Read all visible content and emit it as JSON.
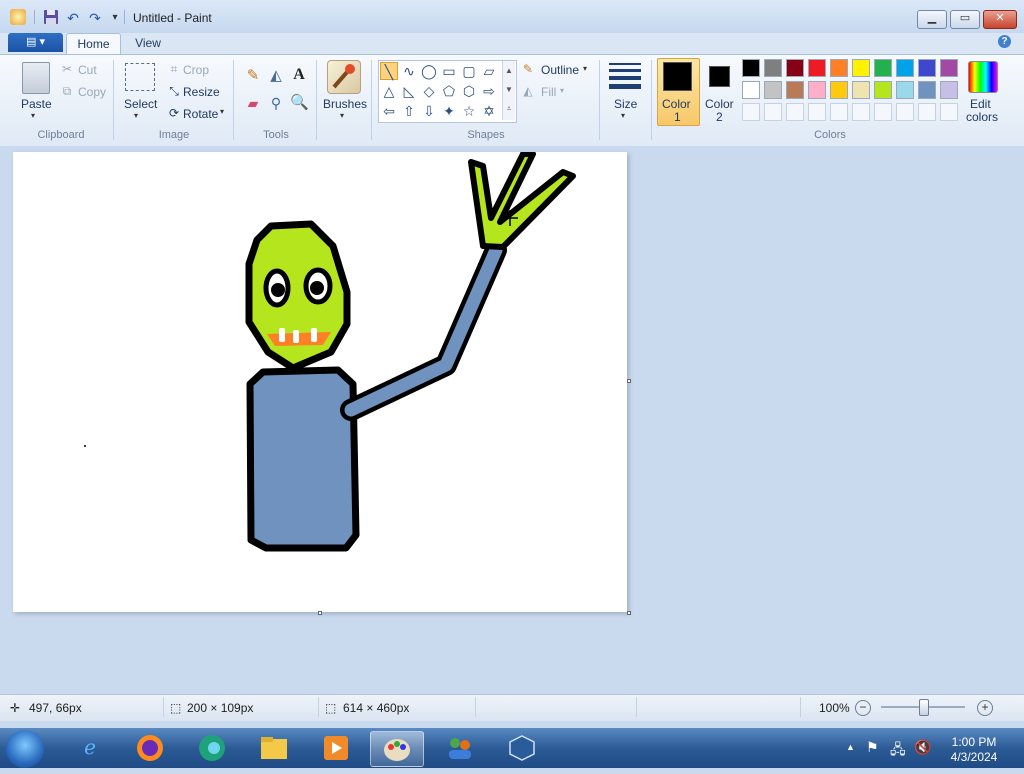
{
  "window": {
    "title": "Untitled - Paint"
  },
  "tabs": {
    "file_label": "▤ ▾",
    "home": "Home",
    "view": "View",
    "help": "?"
  },
  "clipboard": {
    "paste": "Paste",
    "cut": "Cut",
    "copy": "Copy",
    "group": "Clipboard"
  },
  "image": {
    "select": "Select",
    "crop": "Crop",
    "resize": "Resize",
    "rotate": "Rotate",
    "group": "Image"
  },
  "tools": {
    "group": "Tools"
  },
  "brushes": {
    "label": "Brushes"
  },
  "shapes": {
    "outline": "Outline",
    "fill": "Fill",
    "group": "Shapes"
  },
  "size": {
    "label": "Size"
  },
  "colors": {
    "color1_label": "Color",
    "color1_num": "1",
    "color2_label": "Color",
    "color2_num": "2",
    "edit_label_1": "Edit",
    "edit_label_2": "colors",
    "group": "Colors",
    "color1": "#000000",
    "color2": "#000000",
    "palette_row1": [
      "#000000",
      "#7f7f7f",
      "#880015",
      "#ed1c24",
      "#ff7f27",
      "#fff200",
      "#22b14c",
      "#00a2e8",
      "#3f48cc",
      "#a349a4"
    ],
    "palette_row2": [
      "#ffffff",
      "#c3c3c3",
      "#b97a57",
      "#ffaec9",
      "#ffc90e",
      "#efe4b0",
      "#b5e61d",
      "#99d9ea",
      "#7092be",
      "#c8bfe7"
    ]
  },
  "status": {
    "cursor_pos": "497, 66px",
    "selection_size": "200 × 109px",
    "image_size": "614 × 460px",
    "zoom": "100%"
  },
  "clock": {
    "time": "1:00 PM",
    "date": "4/3/2024"
  }
}
